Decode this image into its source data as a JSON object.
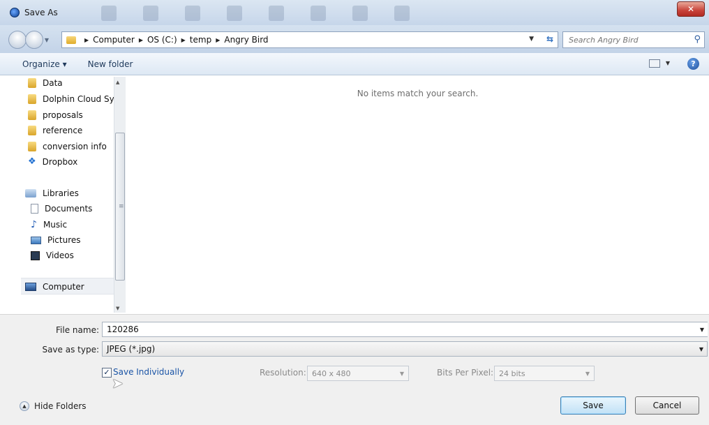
{
  "window": {
    "title": "Save As"
  },
  "address": {
    "crumbs": [
      "Computer",
      "OS (C:)",
      "temp",
      "Angry Bird"
    ]
  },
  "search": {
    "placeholder": "Search Angry Bird"
  },
  "toolbar": {
    "organize": "Organize ▾",
    "new_folder": "New folder"
  },
  "nav": {
    "favorites": [
      {
        "label": "Data",
        "icon": "folder-icon"
      },
      {
        "label": "Dolphin Cloud Sy",
        "icon": "folder-icon"
      },
      {
        "label": "proposals",
        "icon": "folder-icon"
      },
      {
        "label": "reference",
        "icon": "folder-icon"
      },
      {
        "label": "conversion info",
        "icon": "folder-icon"
      },
      {
        "label": "Dropbox",
        "icon": "dropbox-icon"
      }
    ],
    "libraries": {
      "label": "Libraries",
      "icon": "libraries-icon"
    },
    "library_items": [
      {
        "label": "Documents",
        "icon": "documents-icon"
      },
      {
        "label": "Music",
        "icon": "music-icon"
      },
      {
        "label": "Pictures",
        "icon": "pictures-icon"
      },
      {
        "label": "Videos",
        "icon": "videos-icon"
      }
    ],
    "computer": {
      "label": "Computer",
      "icon": "computer-icon"
    }
  },
  "content": {
    "empty_message": "No items match your search."
  },
  "form": {
    "file_name_label": "File name:",
    "file_name_value": "120286",
    "save_type_label": "Save as type:",
    "save_type_value": "JPEG (*.jpg)",
    "save_individually_label": "Save Individually",
    "save_individually_checked": true,
    "resolution_label": "Resolution:",
    "resolution_value": "640 x 480",
    "bits_label": "Bits Per Pixel:",
    "bits_value": "24 bits"
  },
  "footer": {
    "hide_folders": "Hide Folders",
    "save_button": "Save",
    "cancel_button": "Cancel"
  },
  "colors": {
    "titlebar": "#c6d6ea",
    "close": "#c8433a",
    "link": "#1a54a6",
    "panel": "#f0f0f0"
  }
}
